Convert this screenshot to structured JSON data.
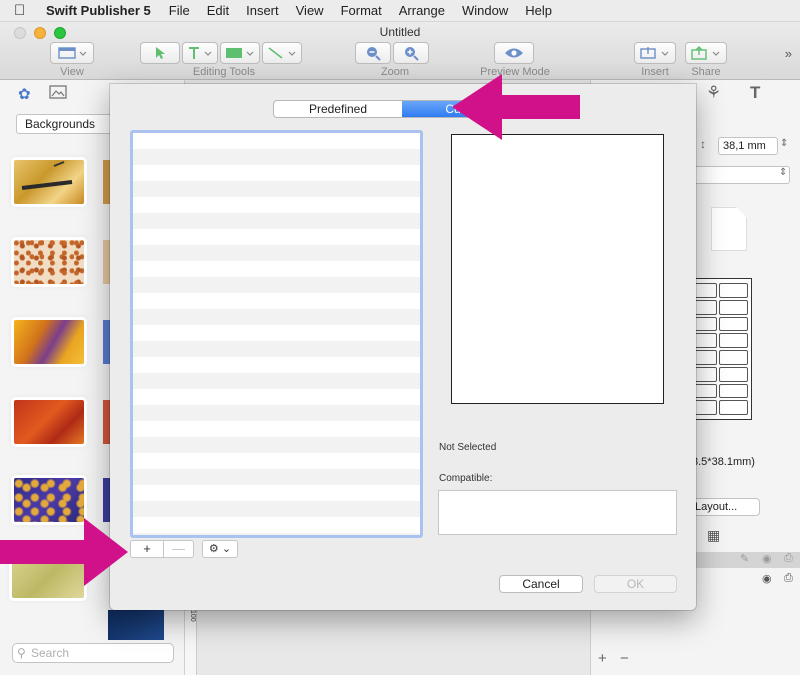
{
  "menubar": {
    "app_name": "Swift Publisher 5",
    "items": [
      "File",
      "Edit",
      "Insert",
      "View",
      "Format",
      "Arrange",
      "Window",
      "Help"
    ]
  },
  "window": {
    "title": "Untitled"
  },
  "toolbar": {
    "view_label": "View",
    "editing_tools_label": "Editing Tools",
    "zoom_label": "Zoom",
    "preview_mode_label": "Preview Mode",
    "insert_label": "Insert",
    "share_label": "Share"
  },
  "left_panel": {
    "category": "Backgrounds",
    "search_placeholder": "Search"
  },
  "right_panel": {
    "height_value": "38,1 mm",
    "size_text": "3.5*38.1mm)",
    "layout_button": "Layout..."
  },
  "canvas": {
    "ruler_mark": "100"
  },
  "dialog": {
    "tabs": [
      "Predefined",
      "Custom"
    ],
    "active_tab": "Custom",
    "not_selected": "Not Selected",
    "compatible_label": "Compatible:",
    "cancel": "Cancel",
    "ok": "OK",
    "add": "+",
    "remove": "—",
    "gear": "⚙ ⌄"
  },
  "colors": {
    "accent": "#2f7cf0",
    "list_focus": "#a9c2f0",
    "annotation_arrow": "#d0118a"
  }
}
